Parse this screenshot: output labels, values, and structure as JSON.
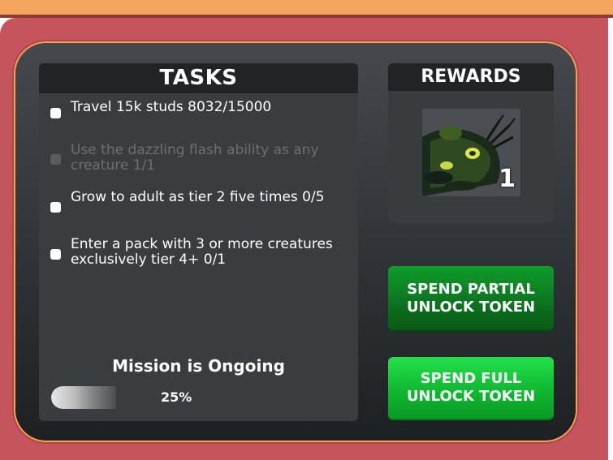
{
  "tasks": {
    "title": "TASKS",
    "items": [
      {
        "text": "Travel 15k studs 8032/15000",
        "completed": false
      },
      {
        "text": "Use the dazzling flash ability as any creature 1/1",
        "completed": true
      },
      {
        "text": "Grow to adult as tier 2 five times 0/5",
        "completed": false
      },
      {
        "text": "Enter a pack with 3 or more creatures exclusively tier 4+ 0/1",
        "completed": false
      }
    ],
    "mission_status": "Mission is Ongoing",
    "progress_label": "25%",
    "progress_fraction": 0.25
  },
  "rewards": {
    "title": "REWARDS",
    "item": {
      "icon": "creature-icon",
      "count": "1"
    }
  },
  "buttons": {
    "partial": "SPEND PARTIAL\nUNLOCK TOKEN",
    "full": "SPEND FULL\nUNLOCK TOKEN"
  },
  "colors": {
    "accent_orange": "#f3a24c",
    "outer_red": "#c5545c",
    "partial_green": "#0b6b1d",
    "full_green": "#10c033"
  }
}
